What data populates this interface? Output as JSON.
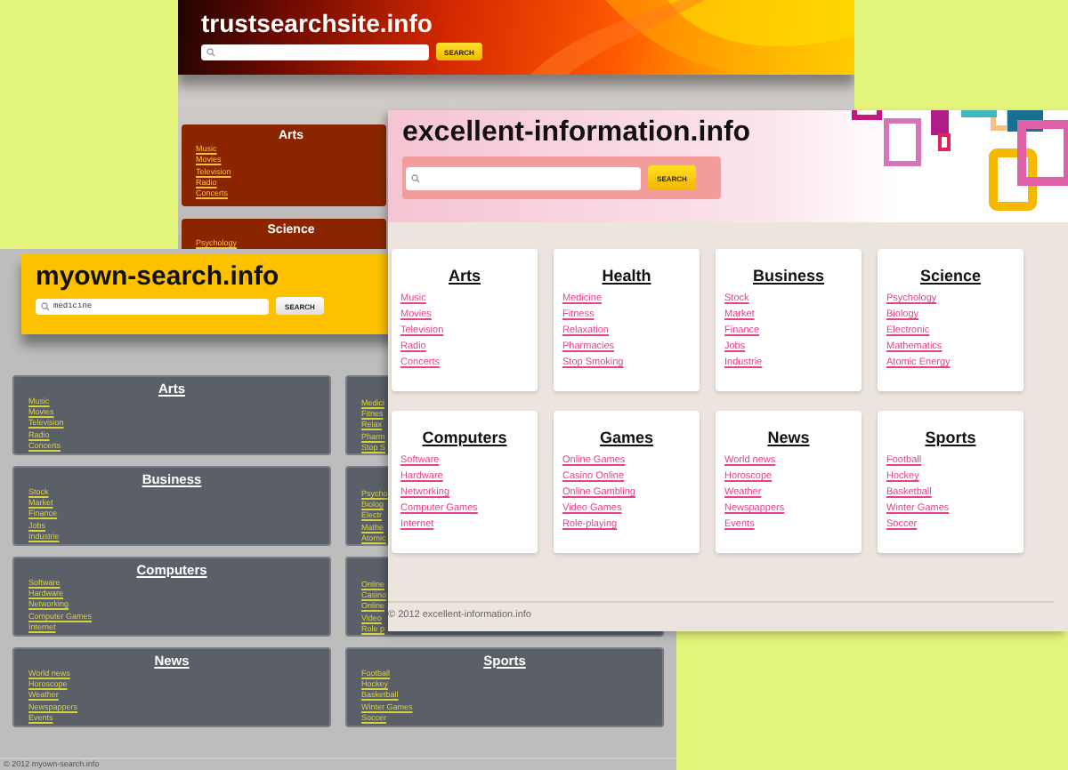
{
  "windows": [
    {
      "kind": "trust",
      "site_title": "trustsearchsite.info",
      "search_button": "SEARCH",
      "categories": [
        {
          "title": "Arts",
          "links": [
            "Music",
            "Movies",
            "Television",
            "Radio",
            "Concerts"
          ]
        },
        {
          "title": "Science",
          "links": [
            "Psychology"
          ]
        }
      ]
    },
    {
      "kind": "myown",
      "site_title": "myown-search.info",
      "search": {
        "value": "medicine"
      },
      "search_button": "SEARCH",
      "categories": [
        {
          "title": "Arts",
          "links": [
            "Music",
            "Movies",
            "Television",
            "Radio",
            "Concerts"
          ]
        },
        {
          "links": [
            "Medici",
            "Fitnes",
            "Relax",
            "Pharm",
            "Stop S"
          ]
        },
        {
          "title": "Business",
          "links": [
            "Stock",
            "Market",
            "Finance",
            "Jobs",
            "Industrie"
          ]
        },
        {
          "links": [
            "Psycho",
            "Biolog",
            "Electr",
            "Mathe",
            "Atomic"
          ]
        },
        {
          "title": "Computers",
          "links": [
            "Software",
            "Hardware",
            "Networking",
            "Computer Games",
            "Internet"
          ]
        },
        {
          "links": [
            "Online",
            "Casino",
            "Online",
            "Video",
            "Role p"
          ]
        },
        {
          "title": "News",
          "links": [
            "World news",
            "Horoscope",
            "Weather",
            "Newspappers",
            "Events"
          ]
        },
        {
          "title": "Sports",
          "links": [
            "Football",
            "Hockey",
            "Basketball",
            "Winter Games",
            "Soccer"
          ]
        }
      ],
      "footer": "© 2012 myown-search.info"
    },
    {
      "kind": "excellent",
      "site_title": "excellent-information.info",
      "search_button": "SEARCH",
      "categories": [
        {
          "title": "Arts",
          "links": [
            "Music",
            "Movies",
            "Television",
            "Radio",
            "Concerts"
          ]
        },
        {
          "title": "Health",
          "links": [
            "Medicine",
            "Fitness",
            "Relaxation",
            "Pharmacies",
            "Stop Smoking"
          ]
        },
        {
          "title": "Business",
          "links": [
            "Stock",
            "Market",
            "Finance",
            "Jobs",
            "Industrie"
          ]
        },
        {
          "title": "Science",
          "links": [
            "Psychology",
            "Biology",
            "Electronic",
            "Mathematics",
            "Atomic Energy"
          ]
        },
        {
          "title": "Computers",
          "links": [
            "Software",
            "Hardware",
            "Networking",
            "Computer Games",
            "Internet"
          ]
        },
        {
          "title": "Games",
          "links": [
            "Online Games",
            "Casino Online",
            "Online Gambling",
            "Video Games",
            "Role-playing"
          ]
        },
        {
          "title": "News",
          "links": [
            "World news",
            "Horoscope",
            "Weather",
            "Newspappers",
            "Events"
          ]
        },
        {
          "title": "Sports",
          "links": [
            "Football",
            "Hockey",
            "Basketball",
            "Winter Games",
            "Soccer"
          ]
        }
      ],
      "footer": "© 2012 excellent-information.info"
    }
  ]
}
